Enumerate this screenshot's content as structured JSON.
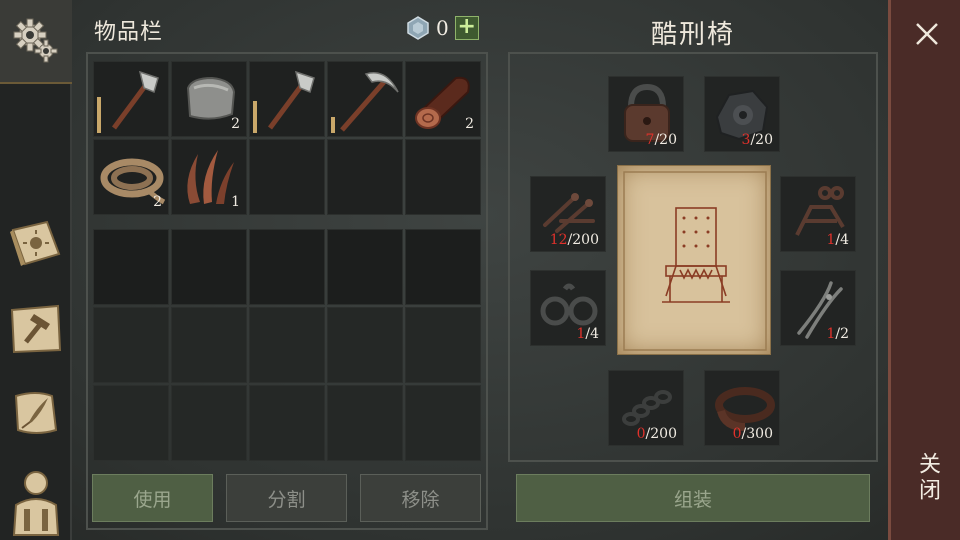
{
  "inventory": {
    "title": "物品栏",
    "currency_value": "0",
    "currency_add": "+",
    "items": [
      {
        "icon": "hatchet-icon",
        "qty": "",
        "durability": 0.55
      },
      {
        "icon": "stone-icon",
        "qty": "2"
      },
      {
        "icon": "hatchet-icon",
        "qty": "",
        "durability": 0.5
      },
      {
        "icon": "pickaxe-icon",
        "qty": "",
        "durability": 0.25
      },
      {
        "icon": "log-icon",
        "qty": "2"
      },
      {
        "icon": "rope-icon",
        "qty": "2"
      },
      {
        "icon": "fiber-icon",
        "qty": "1"
      }
    ],
    "buttons": {
      "use": "使用",
      "split": "分割",
      "remove": "移除"
    }
  },
  "crafting": {
    "title": "酷刑椅",
    "assemble_label": "组装",
    "materials": [
      {
        "icon": "padlock-icon",
        "have": "7",
        "need": "/20"
      },
      {
        "icon": "gear-scrap-icon",
        "have": "3",
        "need": "/20"
      },
      {
        "icon": "nails-icon",
        "have": "12",
        "need": "/200"
      },
      {
        "icon": "handle-frame-icon",
        "have": "1",
        "need": "/4"
      },
      {
        "icon": "shackles-icon",
        "have": "1",
        "need": "/4"
      },
      {
        "icon": "pliers-icon",
        "have": "1",
        "need": "/2"
      },
      {
        "icon": "chain-icon",
        "have": "0",
        "need": "/200"
      },
      {
        "icon": "leather-strap-icon",
        "have": "0",
        "need": "/300"
      }
    ]
  },
  "close_label": "关闭",
  "colors": {
    "shortage": "#e0312b",
    "accent_green": "#4f5f44",
    "close_bar": "#4a2b27"
  }
}
